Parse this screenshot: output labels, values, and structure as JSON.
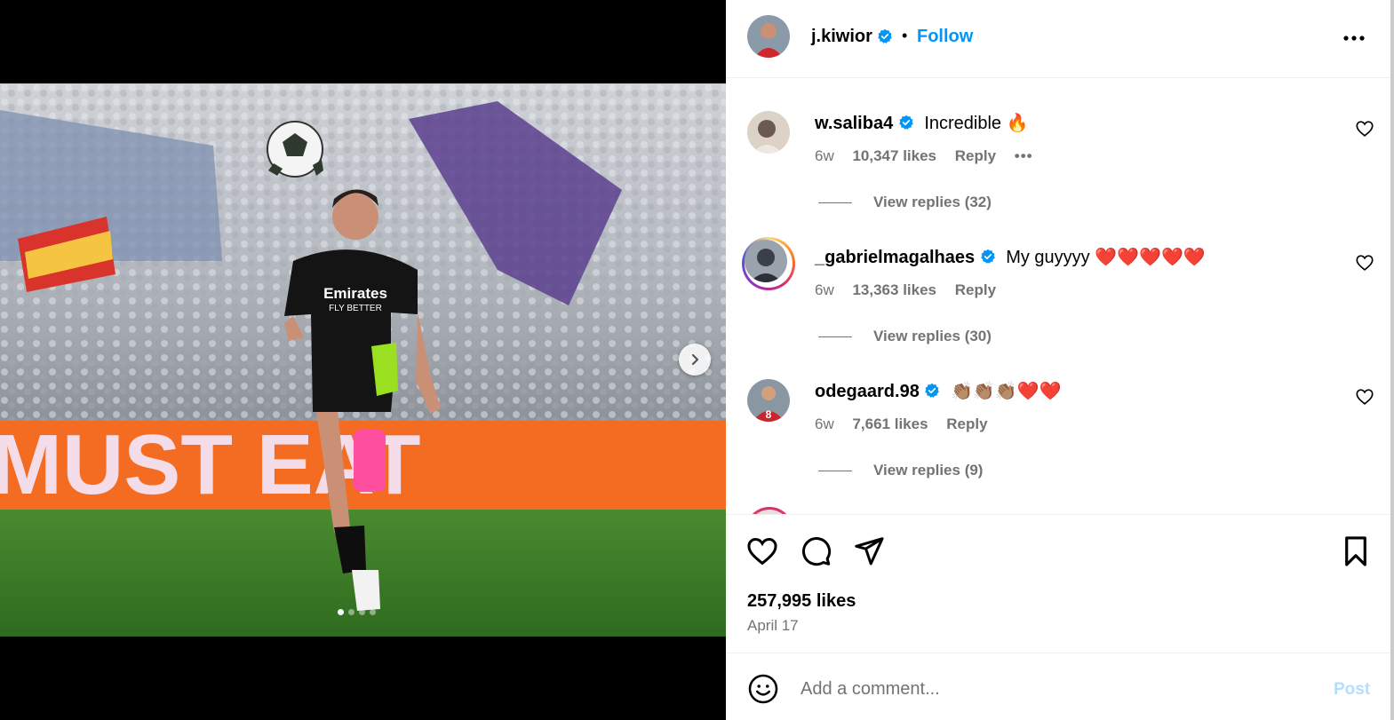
{
  "post": {
    "author": "j.kiwior",
    "follow_label": "Follow",
    "separator": "•",
    "likes": "257,995 likes",
    "date": "April 17",
    "carousel": {
      "slide_count": 4,
      "active_index": 0
    }
  },
  "photo": {
    "ad_board_text": "MUST EAT",
    "kit_sponsor_line1": "Emirates",
    "kit_sponsor_line2": "FLY BETTER"
  },
  "comments": [
    {
      "user": "w.saliba4",
      "text": "Incredible 🔥",
      "age": "6w",
      "likes": "10,347 likes",
      "reply": "Reply",
      "more": "•••",
      "view_replies": "View replies (32)",
      "story_ring": false,
      "avatar_color": "#6b5a52"
    },
    {
      "user": "_gabrielmagalhaes",
      "text": "My guyyyy ❤️❤️❤️❤️❤️",
      "age": "6w",
      "likes": "13,363 likes",
      "reply": "Reply",
      "view_replies": "View replies (30)",
      "story_ring": true,
      "avatar_color": "#3b3f4a"
    },
    {
      "user": "odegaard.98",
      "text": "👏🏽👏🏽👏🏽❤️❤️",
      "age": "6w",
      "likes": "7,661 likes",
      "reply": "Reply",
      "view_replies": "View replies (9)",
      "story_ring": false,
      "avatar_color": "#c9252c"
    }
  ],
  "composer": {
    "placeholder": "Add a comment...",
    "post_label": "Post"
  },
  "icons": {
    "next": "chevron-right-icon",
    "more": "more-horizontal-icon",
    "like": "heart-icon",
    "comment": "comment-icon",
    "share": "send-icon",
    "save": "bookmark-icon",
    "emoji": "emoji-icon",
    "verified": "verified-badge-icon"
  },
  "colors": {
    "link": "#0095f6",
    "verified": "#0095f6",
    "post_disabled": "#b2dffc",
    "secondary_text": "#737373",
    "ad_board": "#f36c21"
  }
}
